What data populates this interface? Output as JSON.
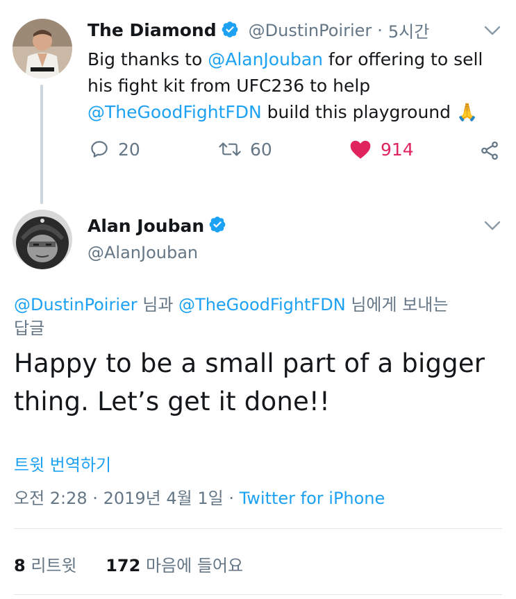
{
  "tweet1": {
    "display_name": "The Diamond",
    "handle": "@DustinPoirier",
    "separator": "·",
    "time": "5시간",
    "text_parts": {
      "p1": "Big thanks to ",
      "m1": "@AlanJouban",
      "p2": " for offering to sell",
      "line2": "his fight kit from UFC236 to help",
      "m2": "@TheGoodFightFDN",
      "p3": " build this playground 🙏"
    },
    "actions": {
      "replies": "20",
      "retweets": "60",
      "likes": "914"
    },
    "icons": [
      "verified-icon",
      "chevron-down-icon",
      "reply-icon",
      "retweet-icon",
      "heart-icon",
      "share-icon"
    ]
  },
  "tweet2": {
    "display_name": "Alan Jouban",
    "handle": "@AlanJouban",
    "reply_to": {
      "m1": "@DustinPoirier",
      "p1": " 님과 ",
      "m2": "@TheGoodFightFDN",
      "p2": " 님에게 보내는",
      "line2": "답글"
    },
    "text_line1": "Happy to be a small part of a bigger",
    "text_line2": "thing. Let’s get it done!!",
    "translate": "트윗 번역하기",
    "timestamp": "오전 2:28 · 2019년 4월 1일 · ",
    "source": "Twitter for iPhone",
    "stats": {
      "retweets_count": "8",
      "retweets_label": " 리트윗",
      "likes_count": "172",
      "likes_label": " 마음에 들어요"
    }
  },
  "colors": {
    "link": "#1da1f2",
    "muted": "#657786",
    "like": "#e0245e",
    "text": "#14171a"
  }
}
